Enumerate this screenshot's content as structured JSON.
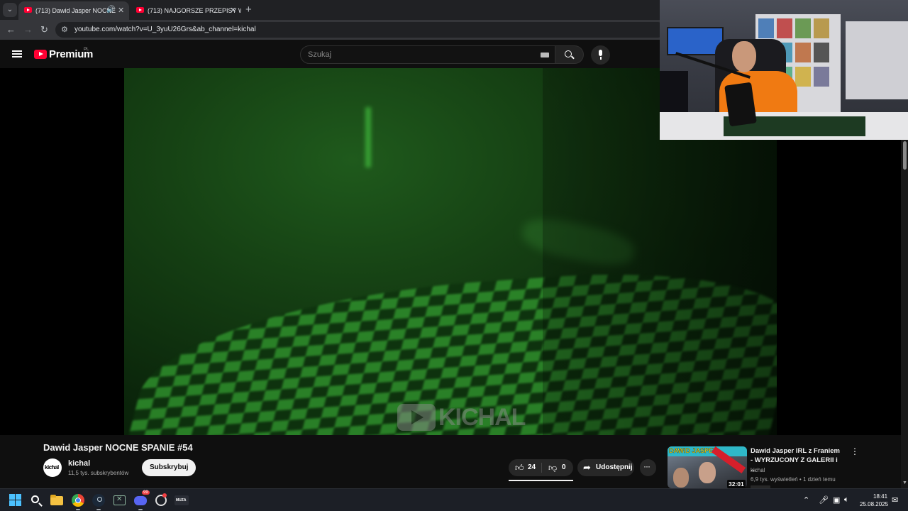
{
  "browser": {
    "tabs": [
      {
        "title": "(713) Dawid Jasper NOCNE",
        "active": true,
        "has_audio": true
      },
      {
        "title": "(713) NAJGORSZE PRZEPISY W",
        "active": false,
        "has_audio": false
      }
    ],
    "new_tab_label": "+",
    "url": "youtube.com/watch?v=U_3yuU26Grs&ab_channel=kichal",
    "icons": {
      "back": "arrow-left-icon",
      "forward": "arrow-right-icon",
      "reload": "reload-icon",
      "site_info": "tune-icon"
    }
  },
  "masthead": {
    "brand": "Premium",
    "region": "PL",
    "search_placeholder": "Szukaj",
    "accent_color": "#ff0033"
  },
  "video": {
    "watermark": "KICHAL",
    "title": "Dawid Jasper NOCNE SPANIE #54",
    "channel": {
      "name": "kichal",
      "avatar_text": "kichal",
      "subscribers": "11,5 tys. subskrybentów"
    },
    "subscribe_label": "Subskrybuj",
    "likes": "24",
    "dislikes": "0",
    "share_label": "Udostępnij",
    "more_label": "···"
  },
  "recommended": [
    {
      "thumbnail_text": "DAWID JASPER",
      "duration": "32:01",
      "title": "Dawid Jasper IRL z Franiem - WYRZUCONY Z GALERII i ...",
      "channel": "kichal",
      "views": "6,9 tys. wyświetleń",
      "age": "1 dzień temu"
    }
  ],
  "taskbar": {
    "pinned": [
      "windows-start-icon",
      "search-icon",
      "file-explorer-icon",
      "chrome-icon",
      "steam-icon",
      "excel-icon",
      "discord-icon",
      "app-icon",
      "muza-icon"
    ],
    "muza_label": "MUZA",
    "discord_badge": "99",
    "time": "18:41",
    "date": "25.08.2025"
  }
}
